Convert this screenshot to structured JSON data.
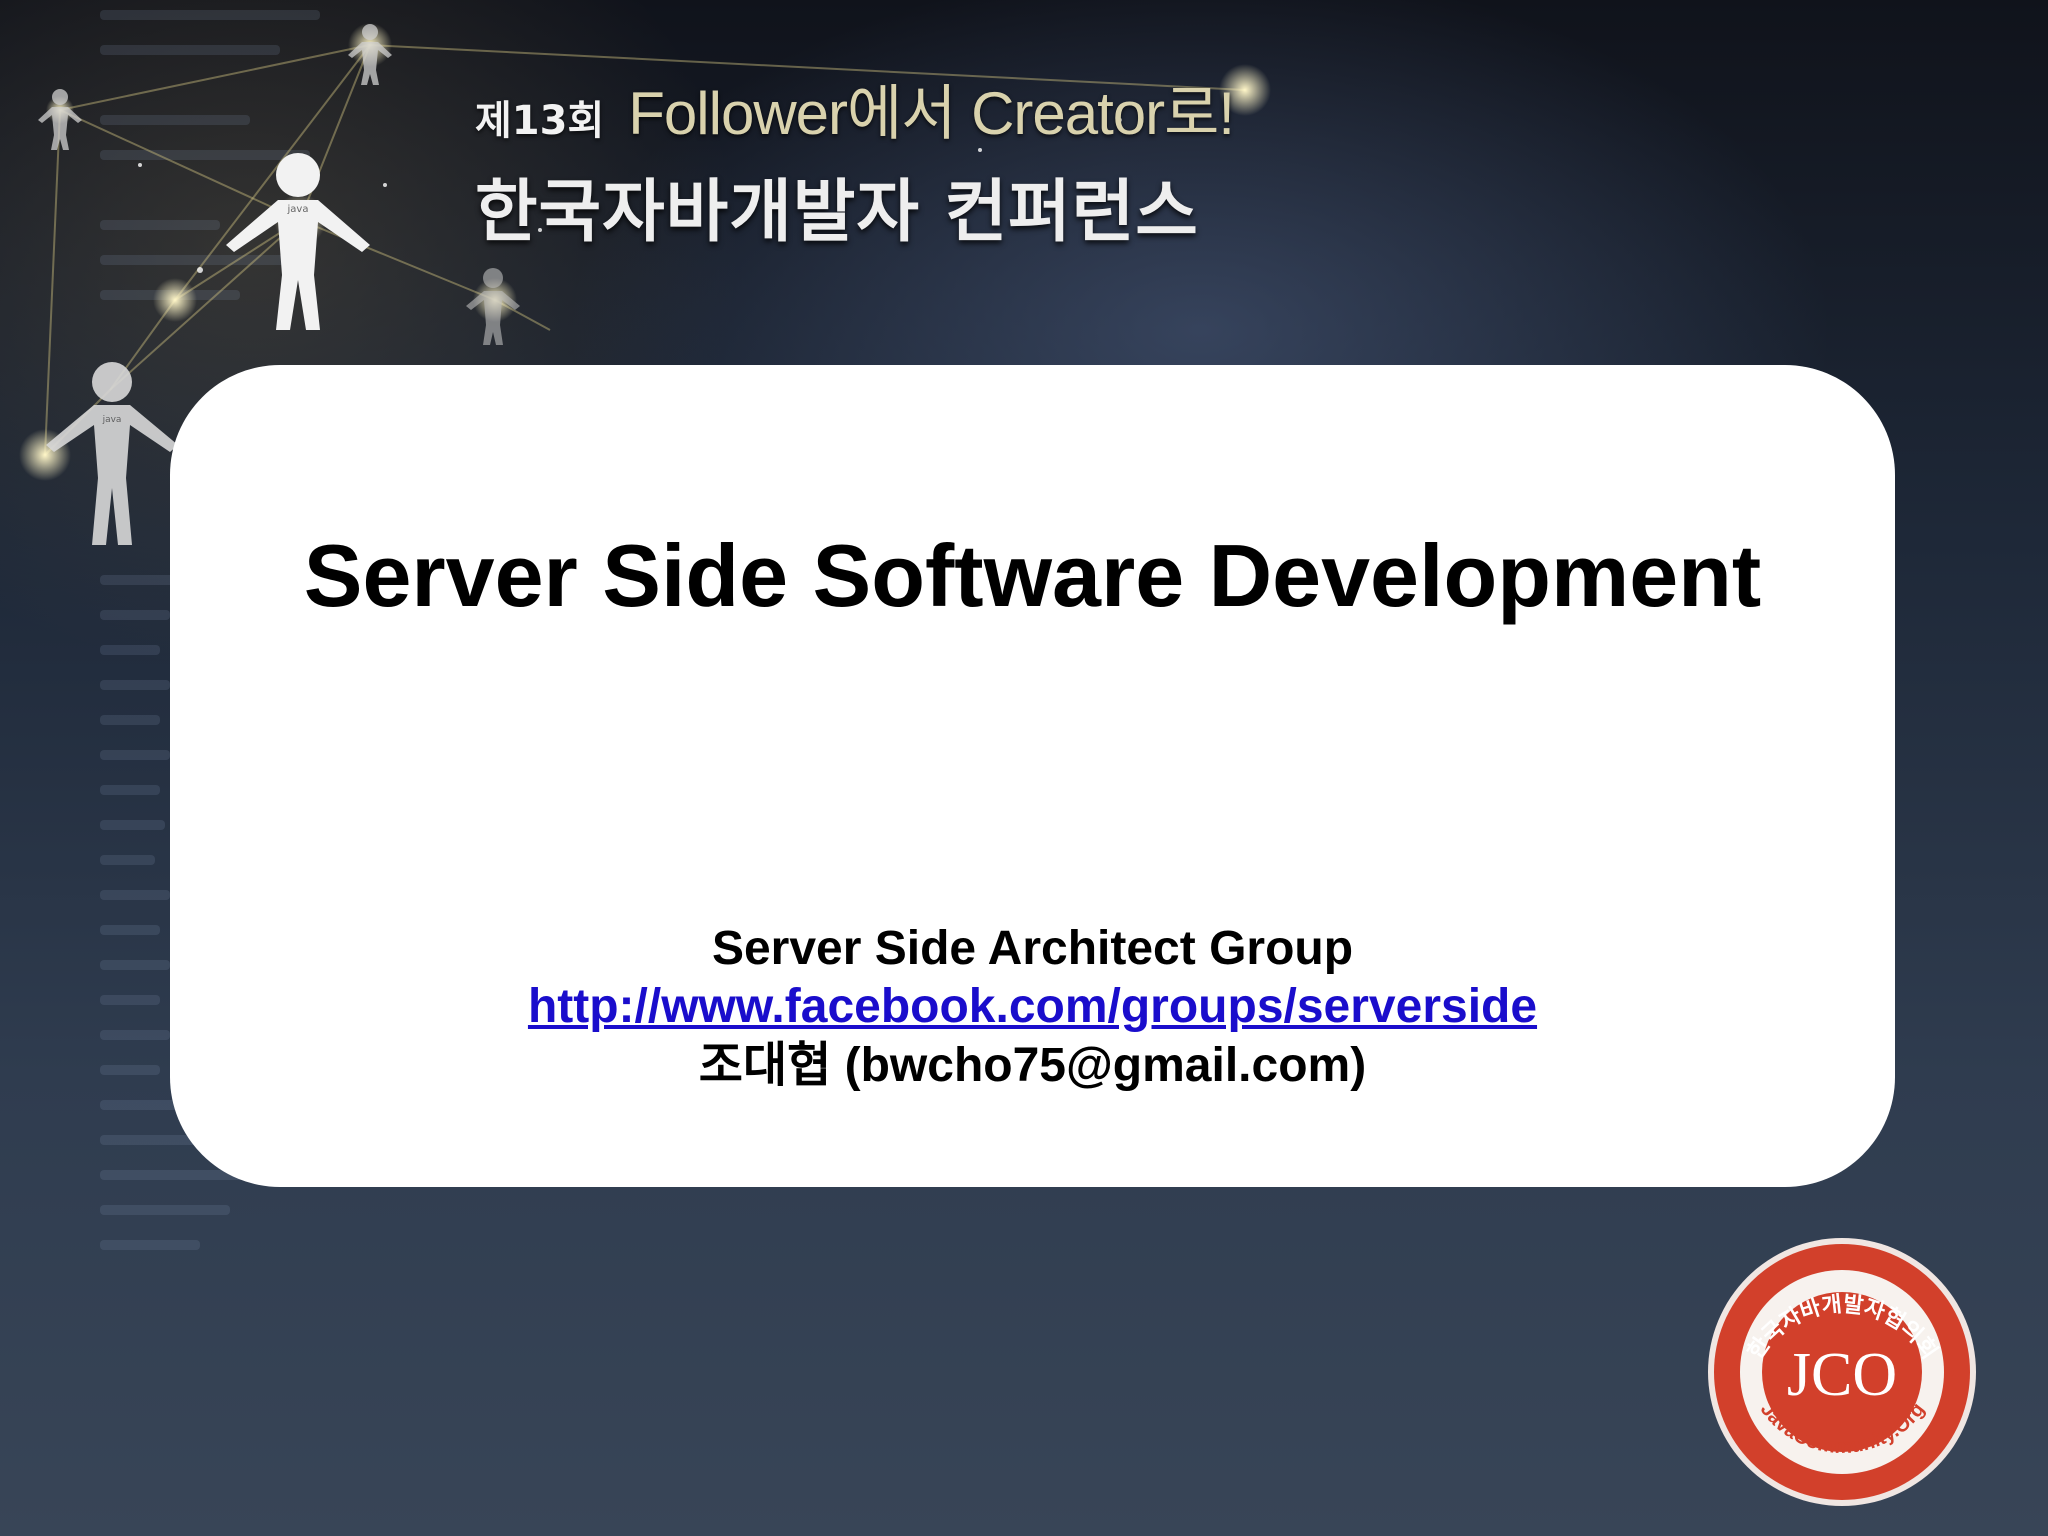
{
  "header": {
    "edition": "제13회",
    "tagline": "Follower에서 Creator로!",
    "conference_name": "한국자바개발자 컨퍼런스"
  },
  "slide": {
    "title": "Server Side Software Development",
    "group_name": "Server Side Architect Group",
    "group_link": "http://www.facebook.com/groups/serverside",
    "presenter_name": "조대협",
    "presenter_email": "(bwcho75@gmail.com)"
  },
  "figures": {
    "shirt_text": "java"
  },
  "logo": {
    "monogram": "JCO",
    "ring_text_top": "한국자바개발자협의회",
    "ring_text_bottom": "JavaCommunity.Org"
  },
  "colors": {
    "card": "#ffffff",
    "link": "#1a0dcc",
    "logo_red": "#d2402b",
    "tagline": "#d9d2ad"
  }
}
